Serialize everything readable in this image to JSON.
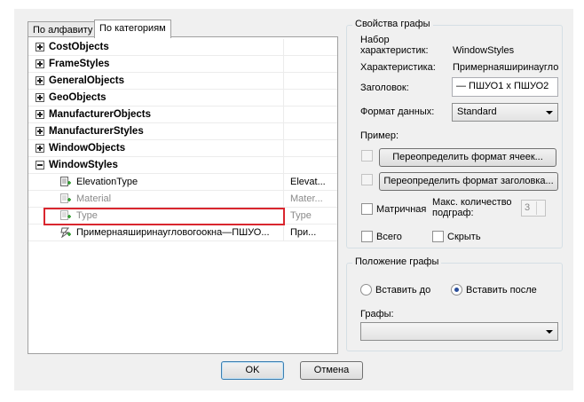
{
  "tabs": [
    {
      "label": "По алфавиту"
    },
    {
      "label": "По категориям"
    }
  ],
  "tree": {
    "groups": [
      {
        "label": "CostObjects",
        "expanded": false
      },
      {
        "label": "FrameStyles",
        "expanded": false
      },
      {
        "label": "GeneralObjects",
        "expanded": false
      },
      {
        "label": "GeoObjects",
        "expanded": false
      },
      {
        "label": "ManufacturerObjects",
        "expanded": false
      },
      {
        "label": "ManufacturerStyles",
        "expanded": false
      },
      {
        "label": "WindowObjects",
        "expanded": false
      },
      {
        "label": "WindowStyles",
        "expanded": true
      }
    ],
    "properties": [
      {
        "label": "ElevationType",
        "value": "Elevat..."
      },
      {
        "label": "Material",
        "value": "Mater..."
      },
      {
        "label": "Type",
        "value": "Type"
      },
      {
        "label": "Примернаяширинаугловогоокна—ПШУО...",
        "value": "При..."
      }
    ]
  },
  "column_properties": {
    "legend": "Свойства графы",
    "set_label": "Набор\nхарактеристик:",
    "set_value": "WindowStyles",
    "property_label": "Характеристика:",
    "property_value": "Примернаяширинаугло",
    "heading_label": "Заголовок:",
    "heading_value": "— ПШУО1 x ПШУО2",
    "format_label": "Формат данных:",
    "format_value": "Standard",
    "example_label": "Пример:",
    "override_cell_button": "Переопределить формат ячеек...",
    "override_header_button": "Переопределить формат заголовка...",
    "matrix_label": "Матричная",
    "max_subheads_label": "Макс. количество\nподграф:",
    "max_subheads_value": "3",
    "total_label": "Всего",
    "hide_label": "Скрыть"
  },
  "column_position": {
    "legend": "Положение графы",
    "insert_before": "Вставить до",
    "insert_after": "Вставить после",
    "columns_label": "Графы:",
    "columns_value": "",
    "selected": "insert_after"
  },
  "buttons": {
    "ok": "OK",
    "cancel": "Отмена"
  }
}
